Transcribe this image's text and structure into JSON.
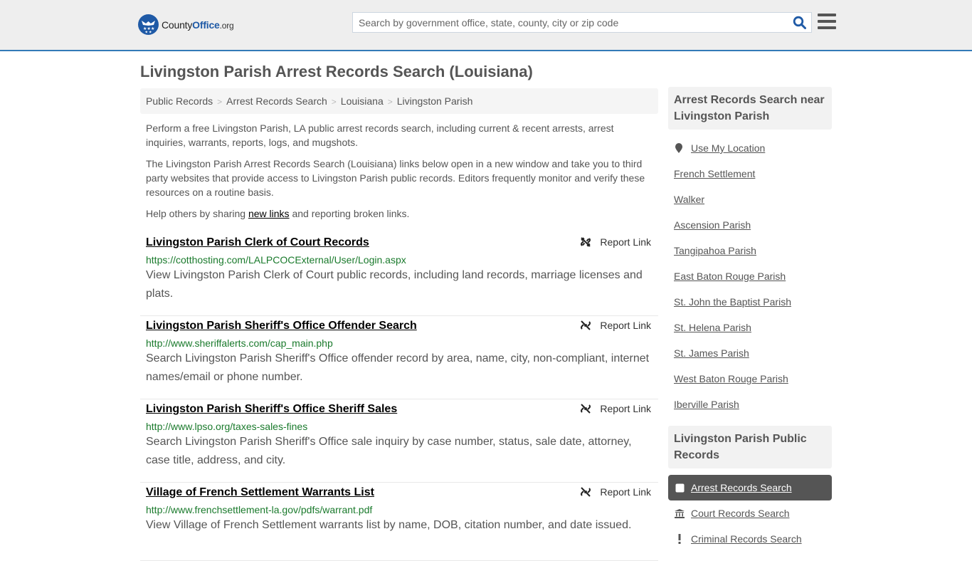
{
  "header": {
    "logo": {
      "part1": "County",
      "part2": "Office",
      "part3": ".org"
    },
    "search_placeholder": "Search by government office, state, county, city or zip code",
    "search_value": "",
    "search_icon": "search-icon",
    "menu_icon": "hamburger-menu-icon",
    "accent_color": "#337ab7"
  },
  "page": {
    "title": "Livingston Parish Arrest Records Search (Louisiana)"
  },
  "breadcrumb": [
    {
      "label": "Public Records"
    },
    {
      "label": "Arrest Records Search"
    },
    {
      "label": "Louisiana"
    },
    {
      "label": "Livingston Parish"
    }
  ],
  "intro": {
    "p1": "Perform a free Livingston Parish, LA public arrest records search, including current & recent arrests, arrest inquiries, warrants, reports, logs, and mugshots.",
    "p2": "The Livingston Parish Arrest Records Search (Louisiana) links below open in a new window and take you to third party websites that provide access to Livingston Parish public records. Editors frequently monitor and verify these resources on a routine basis.",
    "p3_before": "Help others by sharing ",
    "p3_link": "new links",
    "p3_after": " and reporting broken links."
  },
  "results": [
    {
      "title": "Livingston Parish Clerk of Court Records",
      "url": "https://cotthosting.com/LALPCOCExternal/User/Login.aspx",
      "description": "View Livingston Parish Clerk of Court public records, including land records, marriage licenses and plats.",
      "report_label": "Report Link"
    },
    {
      "title": "Livingston Parish Sheriff's Office Offender Search",
      "url": "http://www.sheriffalerts.com/cap_main.php",
      "description": "Search Livingston Parish Sheriff's Office offender record by area, name, city, non-compliant, internet names/email or phone number.",
      "report_label": "Report Link"
    },
    {
      "title": "Livingston Parish Sheriff's Office Sheriff Sales",
      "url": "http://www.lpso.org/taxes-sales-fines",
      "description": "Search Livingston Parish Sheriff's Office sale inquiry by case number, status, sale date, attorney, case title, address, and city.",
      "report_label": "Report Link"
    },
    {
      "title": "Village of French Settlement Warrants List",
      "url": "http://www.frenchsettlement-la.gov/pdfs/warrant.pdf",
      "description": "View Village of French Settlement warrants list by name, DOB, citation number, and date issued.",
      "report_label": "Report Link"
    }
  ],
  "sidebar": {
    "nearby_heading": "Arrest Records Search near Livingston Parish",
    "use_location": "Use My Location",
    "nearby": [
      "French Settlement",
      "Walker",
      "Ascension Parish",
      "Tangipahoa Parish",
      "East Baton Rouge Parish",
      "St. John the Baptist Parish",
      "St. Helena Parish",
      "St. James Parish",
      "West Baton Rouge Parish",
      "Iberville Parish"
    ],
    "public_records_heading": "Livingston Parish Public Records",
    "public_records": [
      {
        "label": "Arrest Records Search",
        "icon": "square-icon",
        "active": true
      },
      {
        "label": "Court Records Search",
        "icon": "courthouse-icon",
        "active": false
      },
      {
        "label": "Criminal Records Search",
        "icon": "exclamation-icon",
        "active": false
      }
    ]
  }
}
